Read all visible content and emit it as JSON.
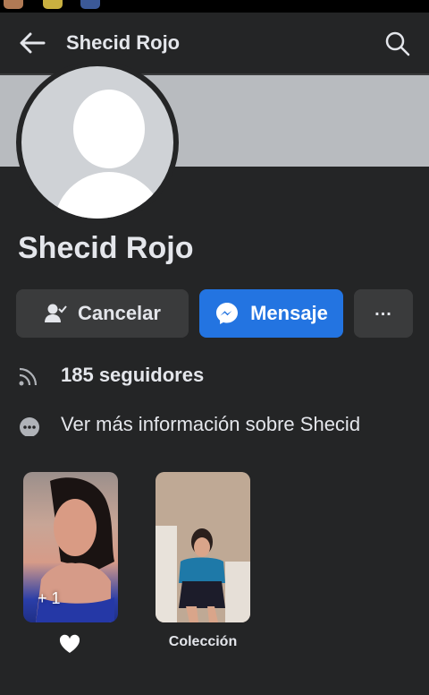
{
  "header": {
    "title": "Shecid Rojo",
    "back_icon": "arrow-left-icon",
    "search_icon": "search-icon"
  },
  "profile": {
    "name": "Shecid Rojo",
    "avatar_icon": "default-user-avatar"
  },
  "actions": {
    "cancel_label": "Cancelar",
    "message_label": "Mensaje",
    "more_label": "...",
    "cancel_icon": "user-check-icon",
    "message_icon": "messenger-icon"
  },
  "info": {
    "followers": "185 seguidores",
    "more_info": "Ver más información sobre Shecid"
  },
  "featured": {
    "items": [
      {
        "count": "+ 1",
        "label_icon": "heart-icon"
      },
      {
        "label": "Colección"
      }
    ]
  },
  "colors": {
    "background": "#242526",
    "surface": "#3a3b3c",
    "accent": "#2374e1",
    "text": "#e4e6eb",
    "cover": "#b8bbbf"
  }
}
